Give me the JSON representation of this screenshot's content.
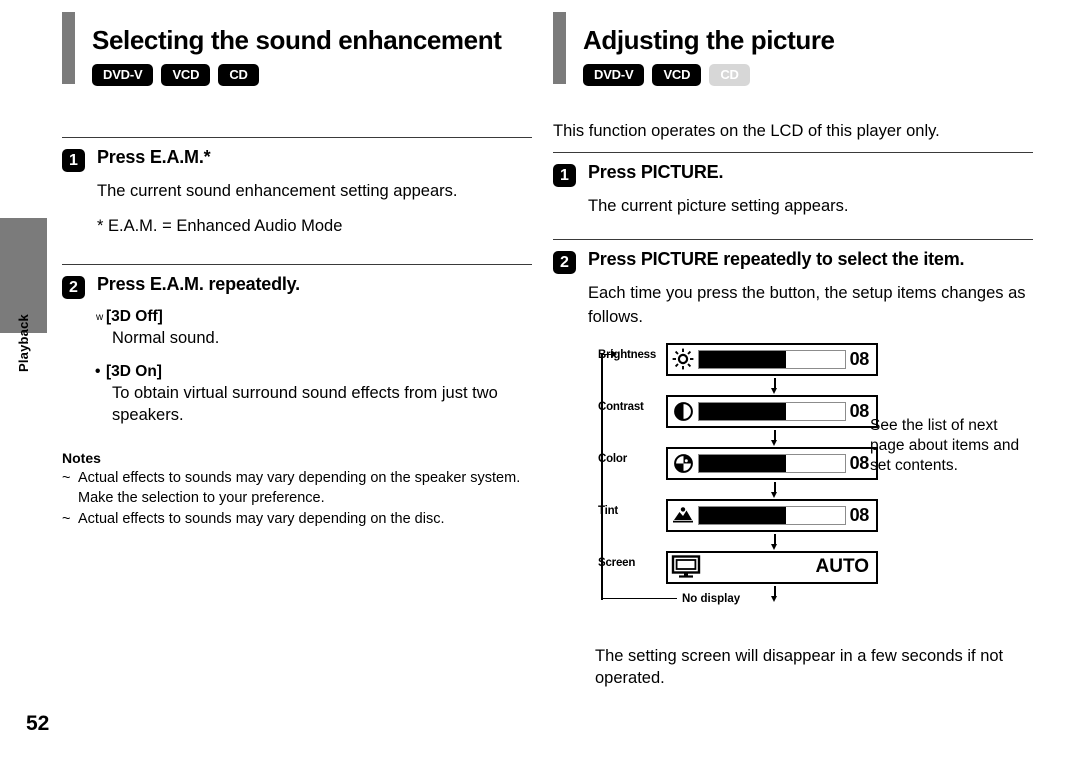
{
  "page": {
    "number": "52",
    "side_tab_label": "Playback"
  },
  "left": {
    "title": "Selecting the sound enhancement",
    "badges": [
      {
        "label": "DVD-V",
        "enabled": true
      },
      {
        "label": "VCD",
        "enabled": true
      },
      {
        "label": "CD",
        "enabled": true
      }
    ],
    "steps": [
      {
        "num": "1",
        "title": "Press E.A.M.*",
        "body": "The current sound enhancement setting appears.",
        "footnote": "* E.A.M. = Enhanced Audio Mode"
      },
      {
        "num": "2",
        "title": "Press E.A.M. repeatedly."
      }
    ],
    "options": [
      {
        "bullet": "w",
        "term": "[3D Off]",
        "desc": "Normal sound."
      },
      {
        "bullet": "•",
        "term": "[3D On]",
        "desc": "To obtain virtual surround sound effects from just two speakers."
      }
    ],
    "notes": {
      "title": "Notes",
      "marker": "~",
      "items": [
        "Actual effects to sounds may vary depending on the speaker system. Make the selection to your preference.",
        "Actual effects to sounds may vary depending on the disc."
      ]
    }
  },
  "right": {
    "title": "Adjusting the picture",
    "badges": [
      {
        "label": "DVD-V",
        "enabled": true
      },
      {
        "label": "VCD",
        "enabled": true
      },
      {
        "label": "CD",
        "enabled": false
      }
    ],
    "intro": "This function operates on the LCD of this player only.",
    "steps": [
      {
        "num": "1",
        "title": "Press PICTURE.",
        "body": "The current picture setting appears."
      },
      {
        "num": "2",
        "title": "Press PICTURE repeatedly to select the item.",
        "body": "Each time you press the button, the setup items changes as follows."
      }
    ],
    "osd": {
      "rows": [
        {
          "label": "Brightness",
          "icon": "brightness-sun-icon",
          "value": "08",
          "fill_percent": 60
        },
        {
          "label": "Contrast",
          "icon": "contrast-half-circle-icon",
          "value": "08",
          "fill_percent": 60
        },
        {
          "label": "Color",
          "icon": "color-wheel-icon",
          "value": "08",
          "fill_percent": 60
        },
        {
          "label": "Tint",
          "icon": "tint-landscape-icon",
          "value": "08",
          "fill_percent": 60
        },
        {
          "label": "Screen",
          "icon": "monitor-screen-icon",
          "value": "AUTO",
          "fill_percent": null
        }
      ],
      "end_label": "No display"
    },
    "side_note": "See the list of next page about items and set contents.",
    "tail_note": "The setting screen will disappear in a few seconds if not operated."
  }
}
